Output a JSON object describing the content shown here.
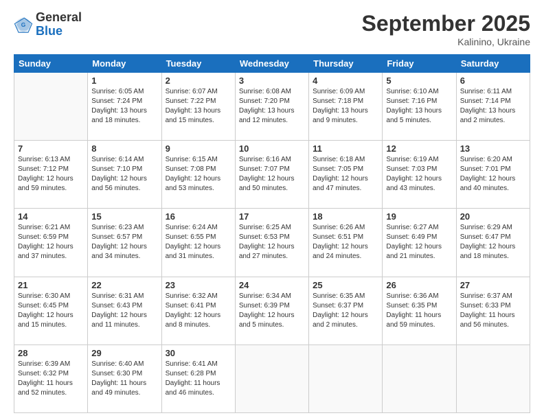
{
  "header": {
    "logo": {
      "general": "General",
      "blue": "Blue"
    },
    "month": "September 2025",
    "location": "Kalinino, Ukraine"
  },
  "weekdays": [
    "Sunday",
    "Monday",
    "Tuesday",
    "Wednesday",
    "Thursday",
    "Friday",
    "Saturday"
  ],
  "weeks": [
    [
      {
        "day": "",
        "empty": true
      },
      {
        "day": "1",
        "sunrise": "6:05 AM",
        "sunset": "7:24 PM",
        "daylight": "13 hours and 18 minutes."
      },
      {
        "day": "2",
        "sunrise": "6:07 AM",
        "sunset": "7:22 PM",
        "daylight": "13 hours and 15 minutes."
      },
      {
        "day": "3",
        "sunrise": "6:08 AM",
        "sunset": "7:20 PM",
        "daylight": "13 hours and 12 minutes."
      },
      {
        "day": "4",
        "sunrise": "6:09 AM",
        "sunset": "7:18 PM",
        "daylight": "13 hours and 9 minutes."
      },
      {
        "day": "5",
        "sunrise": "6:10 AM",
        "sunset": "7:16 PM",
        "daylight": "13 hours and 5 minutes."
      },
      {
        "day": "6",
        "sunrise": "6:11 AM",
        "sunset": "7:14 PM",
        "daylight": "13 hours and 2 minutes."
      }
    ],
    [
      {
        "day": "7",
        "sunrise": "6:13 AM",
        "sunset": "7:12 PM",
        "daylight": "12 hours and 59 minutes."
      },
      {
        "day": "8",
        "sunrise": "6:14 AM",
        "sunset": "7:10 PM",
        "daylight": "12 hours and 56 minutes."
      },
      {
        "day": "9",
        "sunrise": "6:15 AM",
        "sunset": "7:08 PM",
        "daylight": "12 hours and 53 minutes."
      },
      {
        "day": "10",
        "sunrise": "6:16 AM",
        "sunset": "7:07 PM",
        "daylight": "12 hours and 50 minutes."
      },
      {
        "day": "11",
        "sunrise": "6:18 AM",
        "sunset": "7:05 PM",
        "daylight": "12 hours and 47 minutes."
      },
      {
        "day": "12",
        "sunrise": "6:19 AM",
        "sunset": "7:03 PM",
        "daylight": "12 hours and 43 minutes."
      },
      {
        "day": "13",
        "sunrise": "6:20 AM",
        "sunset": "7:01 PM",
        "daylight": "12 hours and 40 minutes."
      }
    ],
    [
      {
        "day": "14",
        "sunrise": "6:21 AM",
        "sunset": "6:59 PM",
        "daylight": "12 hours and 37 minutes."
      },
      {
        "day": "15",
        "sunrise": "6:23 AM",
        "sunset": "6:57 PM",
        "daylight": "12 hours and 34 minutes."
      },
      {
        "day": "16",
        "sunrise": "6:24 AM",
        "sunset": "6:55 PM",
        "daylight": "12 hours and 31 minutes."
      },
      {
        "day": "17",
        "sunrise": "6:25 AM",
        "sunset": "6:53 PM",
        "daylight": "12 hours and 27 minutes."
      },
      {
        "day": "18",
        "sunrise": "6:26 AM",
        "sunset": "6:51 PM",
        "daylight": "12 hours and 24 minutes."
      },
      {
        "day": "19",
        "sunrise": "6:27 AM",
        "sunset": "6:49 PM",
        "daylight": "12 hours and 21 minutes."
      },
      {
        "day": "20",
        "sunrise": "6:29 AM",
        "sunset": "6:47 PM",
        "daylight": "12 hours and 18 minutes."
      }
    ],
    [
      {
        "day": "21",
        "sunrise": "6:30 AM",
        "sunset": "6:45 PM",
        "daylight": "12 hours and 15 minutes."
      },
      {
        "day": "22",
        "sunrise": "6:31 AM",
        "sunset": "6:43 PM",
        "daylight": "12 hours and 11 minutes."
      },
      {
        "day": "23",
        "sunrise": "6:32 AM",
        "sunset": "6:41 PM",
        "daylight": "12 hours and 8 minutes."
      },
      {
        "day": "24",
        "sunrise": "6:34 AM",
        "sunset": "6:39 PM",
        "daylight": "12 hours and 5 minutes."
      },
      {
        "day": "25",
        "sunrise": "6:35 AM",
        "sunset": "6:37 PM",
        "daylight": "12 hours and 2 minutes."
      },
      {
        "day": "26",
        "sunrise": "6:36 AM",
        "sunset": "6:35 PM",
        "daylight": "11 hours and 59 minutes."
      },
      {
        "day": "27",
        "sunrise": "6:37 AM",
        "sunset": "6:33 PM",
        "daylight": "11 hours and 56 minutes."
      }
    ],
    [
      {
        "day": "28",
        "sunrise": "6:39 AM",
        "sunset": "6:32 PM",
        "daylight": "11 hours and 52 minutes."
      },
      {
        "day": "29",
        "sunrise": "6:40 AM",
        "sunset": "6:30 PM",
        "daylight": "11 hours and 49 minutes."
      },
      {
        "day": "30",
        "sunrise": "6:41 AM",
        "sunset": "6:28 PM",
        "daylight": "11 hours and 46 minutes."
      },
      {
        "day": "",
        "empty": true
      },
      {
        "day": "",
        "empty": true
      },
      {
        "day": "",
        "empty": true
      },
      {
        "day": "",
        "empty": true
      }
    ]
  ]
}
